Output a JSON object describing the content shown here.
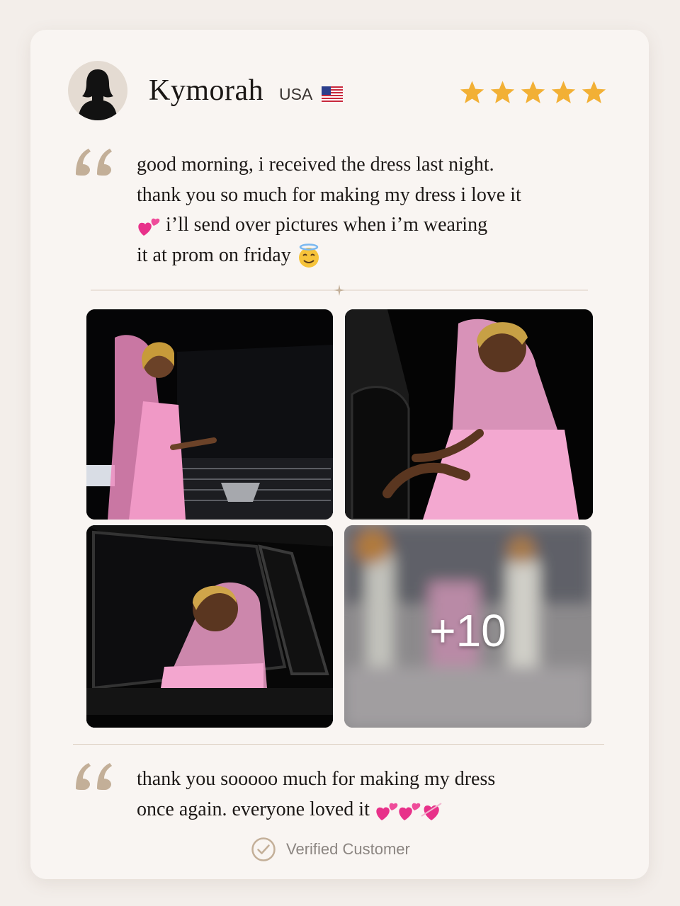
{
  "reviewer": {
    "name": "Kymorah",
    "country": "USA",
    "flag_icon": "us-flag-icon",
    "rating": 5,
    "max_rating": 5
  },
  "review": {
    "line1": "good morning, i received the dress last night.",
    "line2": "thank you so much for making my dress i love it",
    "line3": " i’ll send over pictures when i’m wearing",
    "line4": "it at prom on friday ",
    "line3_emoji": "two-hearts-icon",
    "line4_emoji": "smiling-face-with-halo-icon"
  },
  "photos": {
    "more_count": "+10"
  },
  "followup": {
    "line1": "thank you sooooo much for making my dress",
    "line2": "once again. everyone loved it ",
    "line2_emojis": [
      "two-hearts-icon",
      "two-hearts-icon",
      "heart-with-arrow-icon"
    ]
  },
  "verified_label": "Verified Customer",
  "colors": {
    "background": "#f3eeea",
    "card": "#f9f5f2",
    "star": "#f2b035",
    "quote_mark": "#c3af98",
    "divider": "#ddd0c3"
  }
}
